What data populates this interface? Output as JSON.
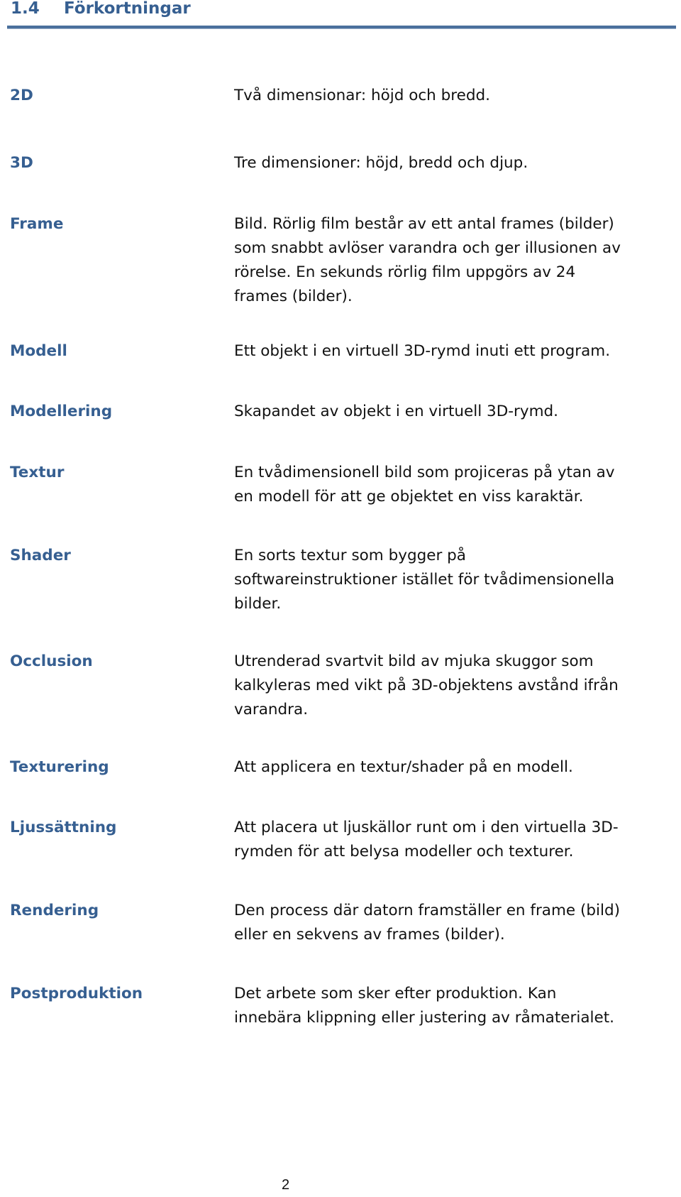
{
  "section": {
    "number": "1.4",
    "title": "Förkortningar"
  },
  "entries": [
    {
      "term": "2D",
      "definition_lines": [
        "Två dimensionar: höjd och bredd."
      ]
    },
    {
      "term": "3D",
      "definition_lines": [
        "Tre dimensioner: höjd, bredd och djup."
      ]
    },
    {
      "term": "Frame",
      "definition_lines": [
        "Bild. Rörlig film består av ett antal frames (bilder)",
        "som snabbt avlöser varandra och ger illusionen av",
        "rörelse. En sekunds rörlig film uppgörs av 24",
        "frames (bilder)."
      ]
    },
    {
      "term": "Modell",
      "definition_lines": [
        "Ett objekt i en virtuell 3D-rymd inuti ett program."
      ]
    },
    {
      "term": "Modellering",
      "definition_lines": [
        "Skapandet av objekt i en virtuell 3D-rymd."
      ]
    },
    {
      "term": "Textur",
      "definition_lines": [
        "En tvådimensionell bild som projiceras på ytan av",
        "en modell för att ge objektet en viss karaktär."
      ]
    },
    {
      "term": "Shader",
      "definition_lines": [
        "En sorts textur som bygger på",
        "softwareinstruktioner istället för tvådimensionella",
        "bilder."
      ]
    },
    {
      "term": "Occlusion",
      "definition_lines": [
        "Utrenderad svartvit bild av mjuka skuggor som",
        "kalkyleras med vikt på 3D-objektens avstånd ifrån",
        "varandra."
      ]
    },
    {
      "term": "Texturering",
      "definition_lines": [
        "Att applicera en textur/shader på en modell."
      ]
    },
    {
      "term": "Ljussättning",
      "definition_lines": [
        "Att placera ut ljuskällor runt om i den virtuella 3D-",
        "rymden för att belysa modeller och texturer."
      ]
    },
    {
      "term": "Rendering",
      "definition_lines": [
        "Den process där datorn framställer en frame (bild)",
        "eller en sekvens av frames (bilder)."
      ]
    },
    {
      "term": "Postproduktion",
      "definition_lines": [
        "Det arbete som sker efter produktion. Kan",
        "innebära klippning eller justering av råmaterialet."
      ]
    }
  ],
  "page_number": "2",
  "colors": {
    "heading": "#365f91",
    "rule": "#4a6f9c",
    "body_text": "#111111"
  }
}
